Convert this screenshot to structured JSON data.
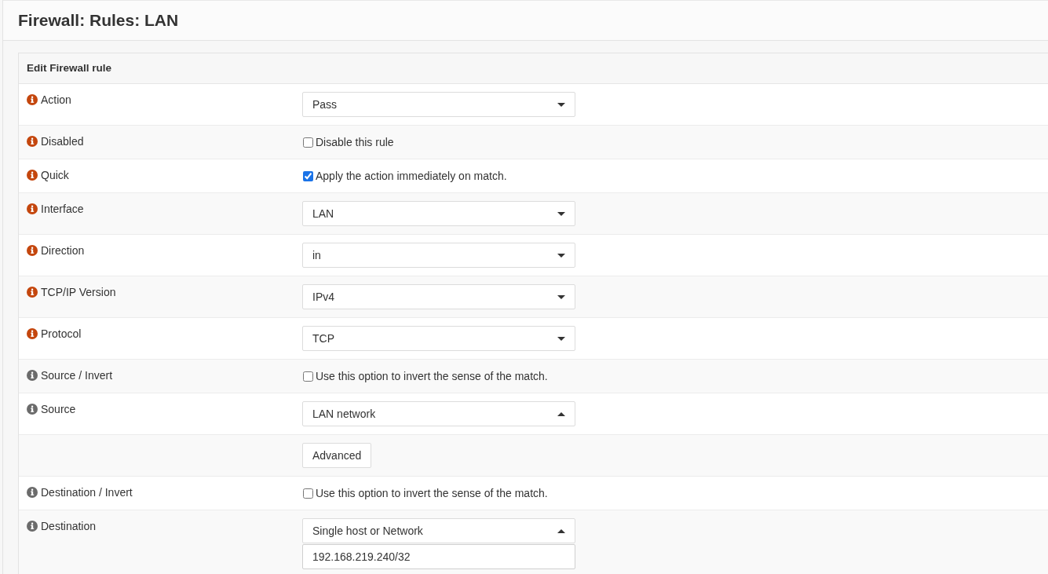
{
  "page": {
    "title": "Firewall: Rules: LAN"
  },
  "panel": {
    "heading": "Edit Firewall rule",
    "rows": [
      {
        "label": "Action",
        "required": true,
        "controls": [
          {
            "kind": "select",
            "value": "Pass",
            "expanded": false
          }
        ]
      },
      {
        "label": "Disabled",
        "required": true,
        "controls": [
          {
            "kind": "checkbox",
            "label": "Disable this rule",
            "checked": false
          }
        ]
      },
      {
        "label": "Quick",
        "required": true,
        "controls": [
          {
            "kind": "checkbox",
            "label": "Apply the action immediately on match.",
            "checked": true
          }
        ]
      },
      {
        "label": "Interface",
        "required": true,
        "controls": [
          {
            "kind": "select",
            "value": "LAN",
            "expanded": false
          }
        ]
      },
      {
        "label": "Direction",
        "required": true,
        "controls": [
          {
            "kind": "select",
            "value": "in",
            "expanded": false
          }
        ]
      },
      {
        "label": "TCP/IP Version",
        "required": true,
        "controls": [
          {
            "kind": "select",
            "value": "IPv4",
            "expanded": false
          }
        ]
      },
      {
        "label": "Protocol",
        "required": true,
        "controls": [
          {
            "kind": "select",
            "value": "TCP",
            "expanded": false
          }
        ]
      },
      {
        "label": "Source / Invert",
        "required": false,
        "controls": [
          {
            "kind": "checkbox",
            "label": "Use this option to invert the sense of the match.",
            "checked": false
          }
        ]
      },
      {
        "label": "Source",
        "required": false,
        "controls": [
          {
            "kind": "select",
            "value": "LAN network",
            "expanded": true
          }
        ]
      },
      {
        "controls": [
          {
            "kind": "button",
            "label": "Advanced"
          }
        ]
      },
      {
        "label": "Destination / Invert",
        "required": false,
        "controls": [
          {
            "kind": "checkbox",
            "label": "Use this option to invert the sense of the match.",
            "checked": false
          }
        ]
      },
      {
        "label": "Destination",
        "required": false,
        "controls": [
          {
            "kind": "select",
            "value": "Single host or Network",
            "expanded": true
          },
          {
            "kind": "input",
            "value": "192.168.219.240/32"
          }
        ]
      }
    ]
  }
}
